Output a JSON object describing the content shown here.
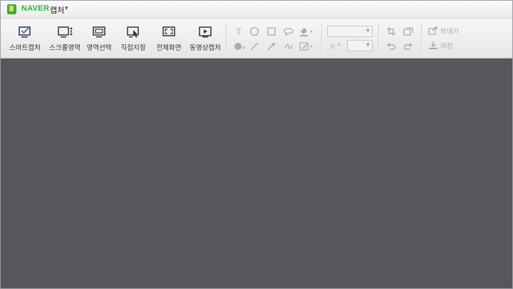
{
  "titlebar": {
    "brand": "NAVER",
    "product": "캡처",
    "menu_arrow": "▾"
  },
  "capture_buttons": [
    {
      "label": "스마트캡처",
      "icon": "smart-capture-icon"
    },
    {
      "label": "스크롤영역",
      "icon": "scroll-capture-icon"
    },
    {
      "label": "영역선택",
      "icon": "region-capture-icon"
    },
    {
      "label": "직접지정",
      "icon": "manual-capture-icon"
    },
    {
      "label": "전체화면",
      "icon": "fullscreen-capture-icon"
    },
    {
      "label": "동영상캡처",
      "icon": "video-capture-icon"
    }
  ],
  "drawing_tools": {
    "row1": [
      "text-icon",
      "circle-icon",
      "rectangle-icon",
      "speech-bubble-icon",
      "fill-icon"
    ],
    "row2": [
      "dot-icon",
      "line-icon",
      "arrow-icon",
      "freehand-icon",
      "edit-icon"
    ],
    "text_glyph": "T"
  },
  "format": {
    "font_size_label": "가",
    "font_combo_value": "",
    "size_combo_value": ""
  },
  "edit_tools": [
    "crop-icon",
    "resize-icon",
    "undo-icon",
    "redo-icon"
  ],
  "actions": {
    "send_label": "보내기",
    "save_label": "저장"
  },
  "colors": {
    "canvas": "#56575b",
    "brand_green": "#2fb041",
    "toolbar_bg": "#efefef"
  }
}
